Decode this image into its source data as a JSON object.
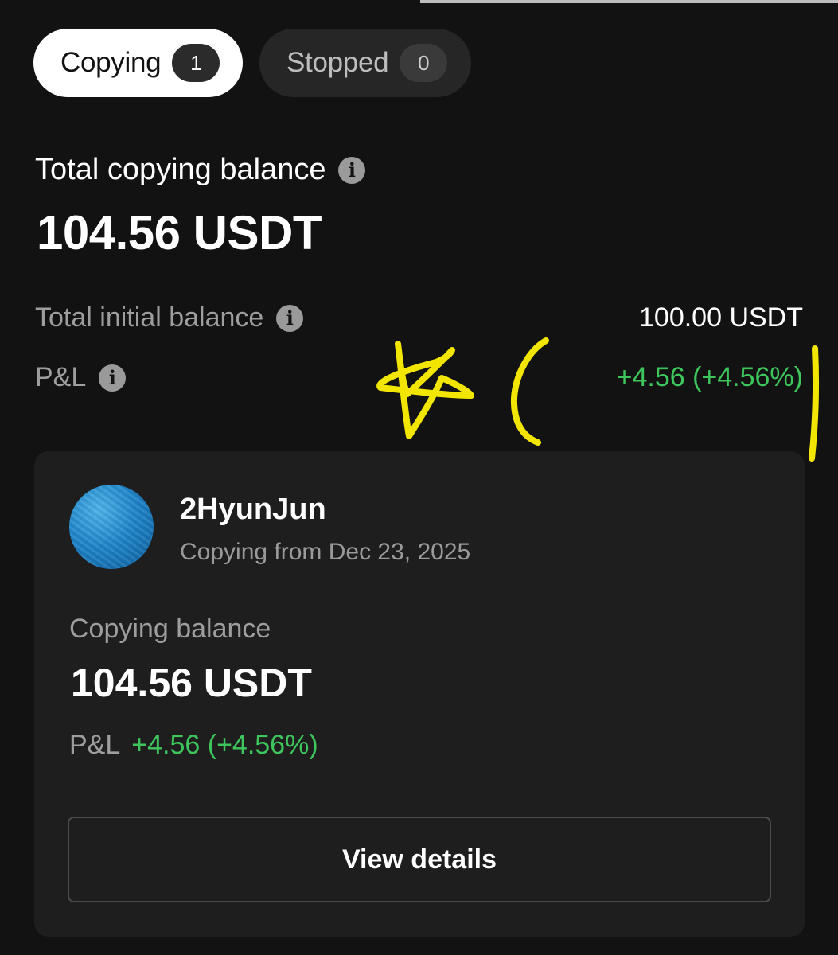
{
  "tabs": {
    "copying": {
      "label": "Copying",
      "count": "1"
    },
    "stopped": {
      "label": "Stopped",
      "count": "0"
    }
  },
  "summary": {
    "total_copying_balance_label": "Total copying balance",
    "total_copying_balance_value": "104.56 USDT",
    "total_initial_balance_label": "Total initial balance",
    "total_initial_balance_value": "100.00 USDT",
    "pnl_label": "P&L",
    "pnl_value": "+4.56 (+4.56%)"
  },
  "trader_card": {
    "name": "2HyunJun",
    "copying_since": "Copying from Dec 23, 2025",
    "copying_balance_label": "Copying balance",
    "copying_balance_value": "104.56 USDT",
    "pnl_label": "P&L",
    "pnl_value": "+4.56 (+4.56%)",
    "view_details_label": "View details"
  },
  "icons": {
    "info": "info-icon"
  },
  "colors": {
    "background": "#121212",
    "card": "#1e1e1e",
    "positive": "#3ec55c",
    "annotation": "#f2e600"
  }
}
